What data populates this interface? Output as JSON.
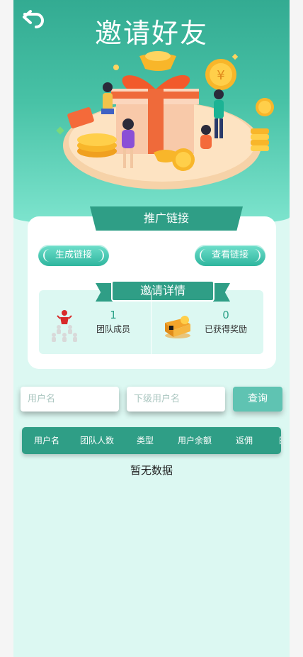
{
  "page": {
    "title": "邀请好友",
    "back_icon": "back-arrow-icon"
  },
  "promo_card": {
    "header": "推广链接",
    "generate_label": "生成链接",
    "view_label": "查看链接"
  },
  "invite_details": {
    "header": "邀请详情",
    "team": {
      "value": "1",
      "label": "团队成员",
      "icon": "team-pyramid-icon"
    },
    "reward": {
      "value": "0",
      "label": "已获得奖励",
      "icon": "reward-box-icon"
    }
  },
  "search": {
    "username_placeholder": "用户名",
    "subuser_placeholder": "下级用户名",
    "query_label": "查询"
  },
  "table": {
    "columns": [
      "用户名",
      "团队人数",
      "类型",
      "用户余额",
      "返佣",
      "日"
    ],
    "empty_text": "暂无数据"
  },
  "colors": {
    "primary": "#2f9e86",
    "hero_top": "#33ab92",
    "hero_bottom": "#7fe5cf",
    "page_bg": "#dcf8f2"
  }
}
